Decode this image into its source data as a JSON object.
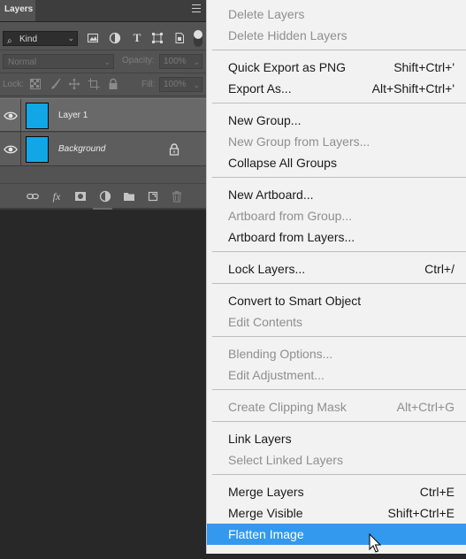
{
  "panel": {
    "tab_label": "Layers",
    "filter": {
      "kind_label": "Kind"
    },
    "blend": {
      "mode": "Normal",
      "opacity_label": "Opacity:",
      "opacity_value": "100%"
    },
    "lock": {
      "label": "Lock:",
      "fill_label": "Fill:",
      "fill_value": "100%"
    },
    "layers": [
      {
        "name": "Layer 1",
        "thumb_color": "#11a7e6"
      },
      {
        "name": "Background",
        "thumb_color": "#11a7e6"
      }
    ]
  },
  "menu": {
    "items": [
      {
        "label": "Delete Layers",
        "shortcut": "",
        "disabled": true
      },
      {
        "label": "Delete Hidden Layers",
        "shortcut": "",
        "disabled": true
      },
      {
        "label": "Quick Export as PNG",
        "shortcut": "Shift+Ctrl+'",
        "disabled": false
      },
      {
        "label": "Export As...",
        "shortcut": "Alt+Shift+Ctrl+'",
        "disabled": false
      },
      {
        "label": "New Group...",
        "shortcut": "",
        "disabled": false
      },
      {
        "label": "New Group from Layers...",
        "shortcut": "",
        "disabled": true
      },
      {
        "label": "Collapse All Groups",
        "shortcut": "",
        "disabled": false
      },
      {
        "label": "New Artboard...",
        "shortcut": "",
        "disabled": false
      },
      {
        "label": "Artboard from Group...",
        "shortcut": "",
        "disabled": true
      },
      {
        "label": "Artboard from Layers...",
        "shortcut": "",
        "disabled": false
      },
      {
        "label": "Lock Layers...",
        "shortcut": "Ctrl+/",
        "disabled": false
      },
      {
        "label": "Convert to Smart Object",
        "shortcut": "",
        "disabled": false
      },
      {
        "label": "Edit Contents",
        "shortcut": "",
        "disabled": true
      },
      {
        "label": "Blending Options...",
        "shortcut": "",
        "disabled": true
      },
      {
        "label": "Edit Adjustment...",
        "shortcut": "",
        "disabled": true
      },
      {
        "label": "Create Clipping Mask",
        "shortcut": "Alt+Ctrl+G",
        "disabled": true
      },
      {
        "label": "Link Layers",
        "shortcut": "",
        "disabled": false
      },
      {
        "label": "Select Linked Layers",
        "shortcut": "",
        "disabled": true
      },
      {
        "label": "Merge Layers",
        "shortcut": "Ctrl+E",
        "disabled": false
      },
      {
        "label": "Merge Visible",
        "shortcut": "Shift+Ctrl+E",
        "disabled": false
      },
      {
        "label": "Flatten Image",
        "shortcut": "",
        "disabled": false,
        "highlighted": true
      }
    ]
  },
  "colors": {
    "accent": "#3399ee",
    "menu_bg": "#f2f2f2",
    "panel_bg": "#535353",
    "workspace_bg": "#282828"
  }
}
